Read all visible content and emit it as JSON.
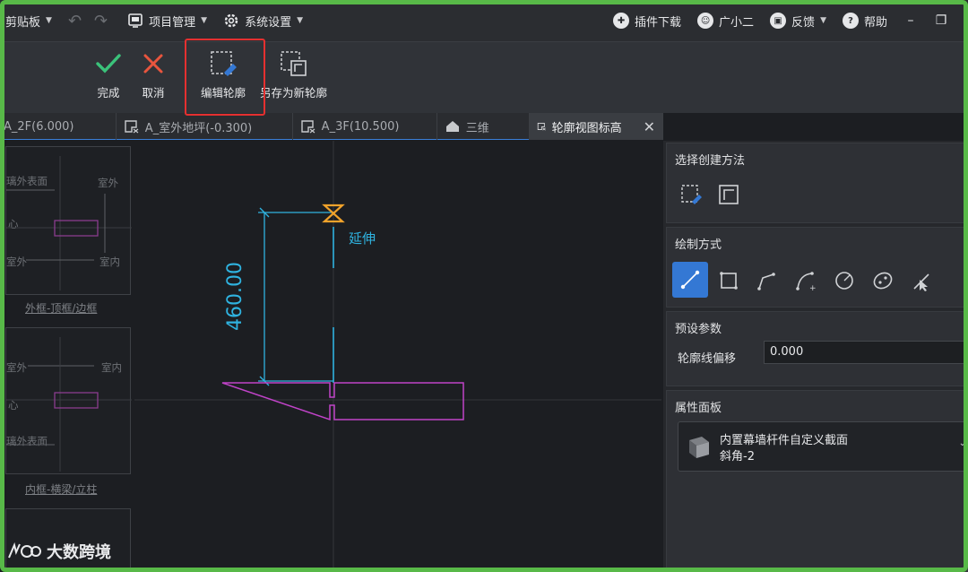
{
  "menubar": {
    "clipboard": "剪贴板",
    "project": "项目管理",
    "settings": "系统设置",
    "plugins": "插件下载",
    "assistant": "广小二",
    "feedback": "反馈",
    "help": "帮助"
  },
  "toolbar": {
    "finish": "完成",
    "cancel": "取消",
    "edit_profile": "编辑轮廓",
    "save_as_profile": "另存为新轮廓"
  },
  "tabs": [
    {
      "label": "A_2F(6.000)"
    },
    {
      "label": "A_室外地坪(-0.300)"
    },
    {
      "label": "A_3F(10.500)"
    },
    {
      "label": "三维"
    },
    {
      "label": "轮廓视图标高",
      "active": true
    }
  ],
  "canvas": {
    "dimension": "460.00",
    "extend_label": "延伸",
    "thumbs": [
      {
        "caption": "外框-顶框/边框",
        "t1": "璃外表面",
        "t2": "室外",
        "t3": "心",
        "t4": "室外",
        "t5": "室内"
      },
      {
        "caption": "内框-横梁/立柱",
        "t1": "室外",
        "t2": "室内",
        "t3": "心",
        "t4": "璃外表面"
      }
    ]
  },
  "panel": {
    "create_method_title": "选择创建方法",
    "draw_method_title": "绘制方式",
    "preset_title": "预设参数",
    "offset_label": "轮廓线偏移",
    "offset_value": "0.000",
    "property_title": "属性面板",
    "property_name": "内置幕墙杆件自定义截面",
    "property_sub": "斜角-2"
  },
  "watermark": "大数跨境",
  "colors": {
    "accent_blue": "#3478d4",
    "dimension_cyan": "#2fb3e0",
    "profile_magenta": "#c043c8",
    "highlight_red": "#e53030",
    "frame_green": "#58b948"
  }
}
